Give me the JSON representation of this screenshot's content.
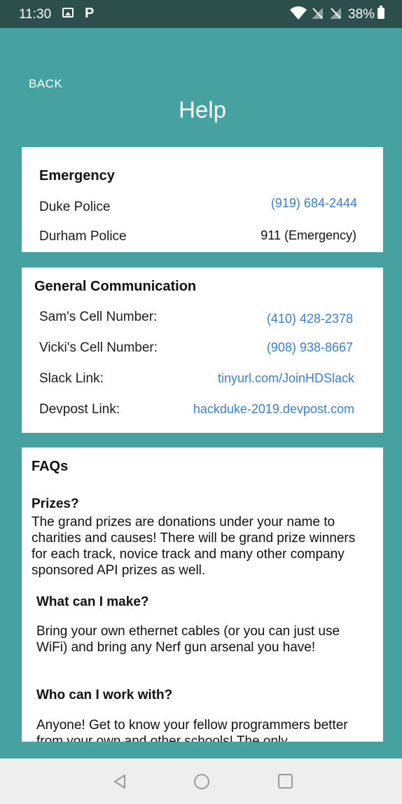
{
  "status_bar": {
    "time": "11:30",
    "battery": "38%",
    "icons": [
      "image-icon",
      "parking-app-icon",
      "wifi-icon",
      "no-signal-icon",
      "no-signal-icon",
      "battery-icon"
    ]
  },
  "header": {
    "back_label": "BACK",
    "title": "Help"
  },
  "emergency": {
    "title": "Emergency",
    "rows": [
      {
        "label": "Duke Police",
        "value": "(919) 684-2444"
      },
      {
        "label": "Durham Police",
        "value": "911 (Emergency)"
      }
    ]
  },
  "general": {
    "title": "General Communication",
    "rows": [
      {
        "label": "Sam's Cell Number:",
        "value": "(410) 428-2378"
      },
      {
        "label": "Vicki's Cell Number:",
        "value": "(908) 938-8667"
      },
      {
        "label": "Slack Link:",
        "value": "tinyurl.com/JoinHDSlack"
      },
      {
        "label": "Devpost Link:",
        "value": "hackduke-2019.devpost.com"
      }
    ]
  },
  "faq": {
    "title": "FAQs",
    "items": [
      {
        "question": "Prizes?",
        "answer": "The grand prizes are donations under your name to charities and causes! There will be grand prize winners for each track, novice track and many other company sponsored API prizes as well."
      },
      {
        "question": "What can I make?",
        "answer": "Bring your own ethernet cables (or you can just use WiFi) and bring any Nerf gun arsenal you have!"
      },
      {
        "question": "Who can I work with?",
        "answer": "Anyone! Get to know your fellow programmers better from your own and other schools! The only"
      }
    ]
  },
  "colors": {
    "background": "#46a1a1",
    "status_bar": "#2c4f4b",
    "link": "#3d7fc7",
    "card": "#ffffff",
    "nav_bar": "#eeeeee"
  }
}
